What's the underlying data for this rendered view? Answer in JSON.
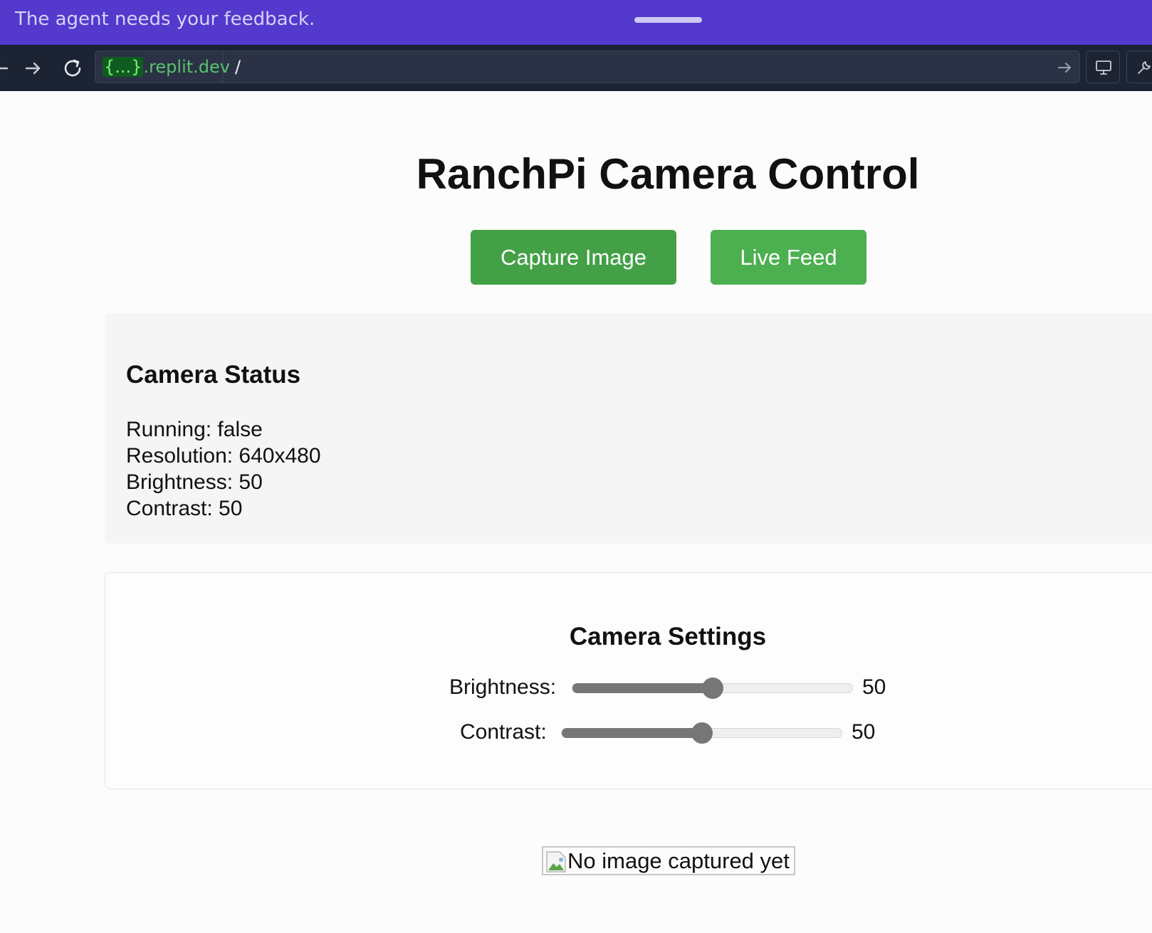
{
  "banner": {
    "text": "The agent needs your feedback."
  },
  "browser": {
    "url_host_highlight": "{...}",
    "url_host_rest": ".replit.dev",
    "url_path": "/",
    "icons": [
      "back-arrow-icon",
      "forward-arrow-icon",
      "reload-icon",
      "go-arrow-icon",
      "monitor-icon",
      "wrench-icon"
    ]
  },
  "page": {
    "title": "RanchPi Camera Control",
    "buttons": {
      "capture": "Capture Image",
      "live": "Live Feed"
    },
    "status": {
      "title": "Camera Status",
      "running": "Running: false",
      "resolution": "Resolution: 640x480",
      "brightness": "Brightness: 50",
      "contrast": "Contrast: 50"
    },
    "settings": {
      "title": "Camera Settings",
      "brightness_label": "Brightness:",
      "brightness_value": "50",
      "brightness_level": 0.5,
      "contrast_label": "Contrast:",
      "contrast_value": "50",
      "contrast_level": 0.5
    },
    "image_alt": "No image captured yet"
  },
  "colors": {
    "banner_bg": "#5439cd",
    "toolbar_bg": "#1c2333",
    "button_green": "#4caf50",
    "button_green_dark": "#43a047"
  }
}
